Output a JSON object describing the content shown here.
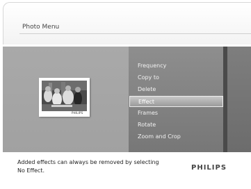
{
  "header": {
    "title": "Photo Menu"
  },
  "menu": {
    "items": [
      {
        "label": "Frequency",
        "selected": false
      },
      {
        "label": "Copy to",
        "selected": false
      },
      {
        "label": "Delete",
        "selected": false
      },
      {
        "label": "Effect",
        "selected": true
      },
      {
        "label": "Frames",
        "selected": false
      },
      {
        "label": "Rotate",
        "selected": false
      },
      {
        "label": "Zoom and Crop",
        "selected": false
      }
    ]
  },
  "thumbnail": {
    "brand_text": "PHILIPS"
  },
  "footer": {
    "hint_line1": "Added effects can always be removed by selecting",
    "hint_line2": "No Effect.",
    "brand": "PHILIPS"
  },
  "colors": {
    "menu_panel": "#8e8e8e",
    "left_panel": "#a9a9a9",
    "selected_item": "#b8b8b8",
    "header_bg": "#f3f3f3"
  }
}
